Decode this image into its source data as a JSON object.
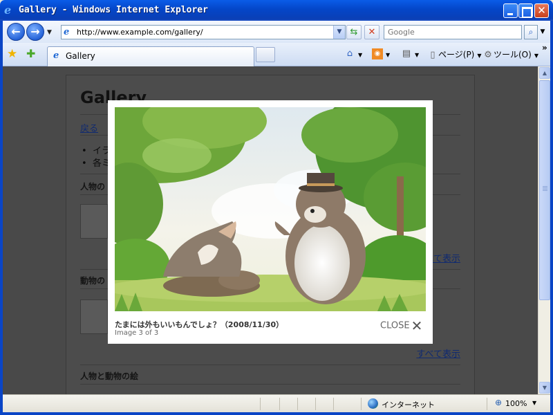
{
  "window": {
    "title": "Gallery - Windows Internet Explorer"
  },
  "nav": {
    "url": "http://www.example.com/gallery/",
    "search_placeholder": "Google"
  },
  "tabs": [
    {
      "label": "Gallery"
    }
  ],
  "commands": {
    "page": "ページ(P)",
    "tools": "ツール(O)"
  },
  "page": {
    "title": "Gallery",
    "back_link": "戻る",
    "bullets": [
      "イラ",
      "各ミ"
    ],
    "sections": [
      {
        "heading": "人物の",
        "show_all": "すべて表示"
      },
      {
        "heading": "動物の",
        "show_all": "すべて表示"
      },
      {
        "heading": "人物と動物の絵"
      }
    ]
  },
  "lightbox": {
    "caption": "たまには外もいいもんでしょ？（2008/11/30）",
    "counter": "Image 3 of 3",
    "close_label": "CLOSE"
  },
  "status": {
    "zone": "インターネット",
    "zoom": "100%"
  }
}
